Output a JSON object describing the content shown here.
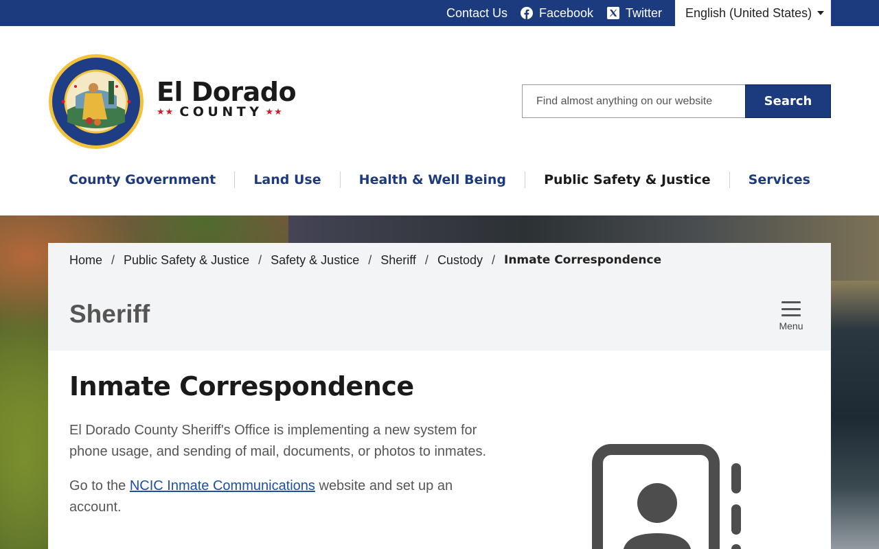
{
  "topbar": {
    "contact_label": "Contact Us",
    "facebook_label": "Facebook",
    "twitter_label": "Twitter",
    "language": "English (United States)"
  },
  "header": {
    "logo_name": "El Dorado",
    "logo_county": "COUNTY",
    "logo_stars": "★★",
    "seal_icon": "county-seal",
    "search": {
      "placeholder": "Find almost anything on our website",
      "value": "",
      "button_label": "Search"
    }
  },
  "nav": {
    "items": [
      {
        "label": "County Government"
      },
      {
        "label": "Land Use"
      },
      {
        "label": "Health & Well Being"
      },
      {
        "label": "Public Safety & Justice",
        "active": true
      },
      {
        "label": "Services"
      }
    ]
  },
  "breadcrumb": {
    "items": [
      "Home",
      "Public Safety & Justice",
      "Safety & Justice",
      "Sheriff",
      "Custody"
    ],
    "current": "Inmate Correspondence",
    "separator": "/"
  },
  "section": {
    "title": "Sheriff",
    "menu_label": "Menu"
  },
  "article": {
    "title": "Inmate Correspondence",
    "paragraph1": "El Dorado County Sheriff's Office is implementing a new system for phone usage, and sending of mail, documents, or photos to inmates.",
    "paragraph2_before": "Go to the ",
    "paragraph2_link": "NCIC Inmate Communications",
    "paragraph2_after": " website and set up an account.",
    "illustration_icon": "contact-book-icon"
  },
  "colors": {
    "brand_blue": "#1c3a7e",
    "link_blue": "#1c4fa0",
    "panel_gray": "#f3f4f6",
    "star_red": "#d7192d"
  }
}
